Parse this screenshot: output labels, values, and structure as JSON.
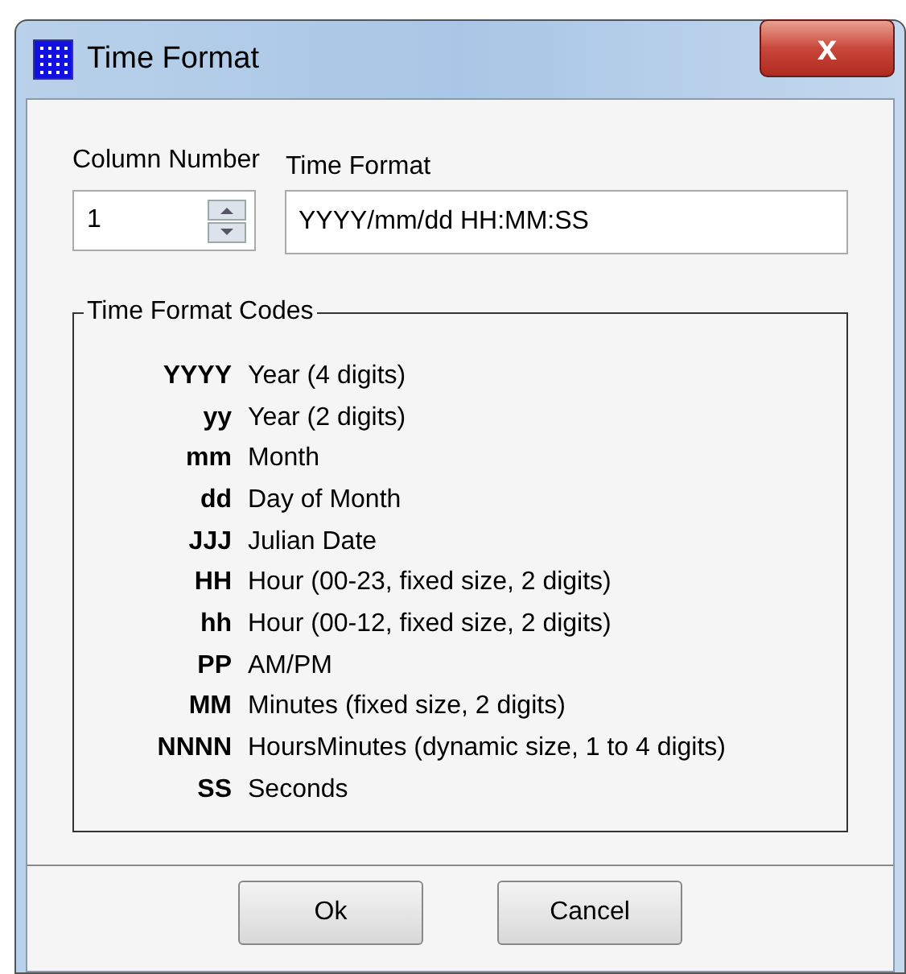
{
  "window": {
    "title": "Time Format",
    "close_glyph": "x"
  },
  "column_number": {
    "label": "Column Number",
    "value": "1"
  },
  "time_format": {
    "label": "Time Format",
    "value": "YYYY/mm/dd HH:MM:SS"
  },
  "codes_group": {
    "title": "Time Format Codes",
    "codes": [
      {
        "code": "YYYY",
        "meaning": "Year (4 digits)"
      },
      {
        "code": "yy",
        "meaning": "Year (2 digits)"
      },
      {
        "code": "mm",
        "meaning": "Month"
      },
      {
        "code": "dd",
        "meaning": "Day of Month"
      },
      {
        "code": "JJJ",
        "meaning": "Julian Date"
      },
      {
        "code": "HH",
        "meaning": "Hour (00-23, fixed size, 2 digits)"
      },
      {
        "code": "hh",
        "meaning": "Hour (00-12, fixed size, 2 digits)"
      },
      {
        "code": "PP",
        "meaning": "AM/PM"
      },
      {
        "code": "MM",
        "meaning": "Minutes (fixed size, 2 digits)"
      },
      {
        "code": "NNNN",
        "meaning": "HoursMinutes (dynamic size, 1 to 4 digits)"
      },
      {
        "code": "SS",
        "meaning": "Seconds"
      }
    ]
  },
  "buttons": [
    "Ok",
    "Cancel"
  ]
}
